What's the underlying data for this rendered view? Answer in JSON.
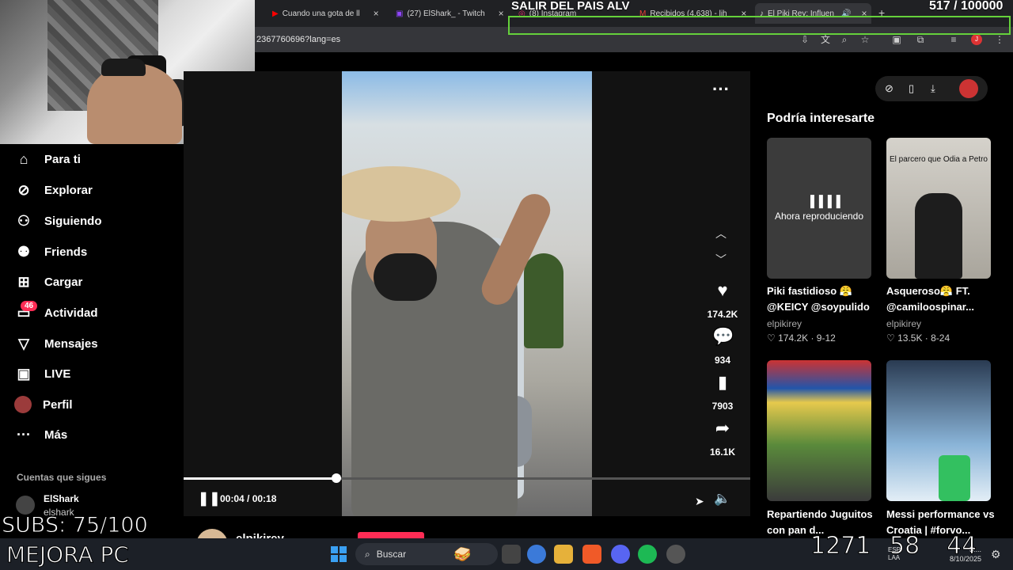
{
  "browser": {
    "tabs": [
      {
        "label": "Cuando una gota de ll",
        "icon": "youtube-icon"
      },
      {
        "label": "(27) ElShark_ - Twitch",
        "icon": "twitch-icon"
      },
      {
        "label": "(8) Instagram",
        "icon": "instagram-icon"
      },
      {
        "label": "Recibidos (4.638) - lih",
        "icon": "gmail-icon"
      },
      {
        "label": "El Piki Rey: Influen",
        "icon": "tiktok-icon"
      }
    ],
    "new_tab": "+",
    "url": "2367760696?lang=es"
  },
  "stream_overlay": {
    "title": "SALIR DEL PAIS ALV",
    "counter": "517   / 100000",
    "subs": "SUBS: 75/100",
    "mejora": "MEJORA PC",
    "num_a": "1271",
    "num_b": "58",
    "num_c": "44"
  },
  "sidebar": {
    "items": [
      {
        "label": "Para ti",
        "icon": "home-icon"
      },
      {
        "label": "Explorar",
        "icon": "compass-icon"
      },
      {
        "label": "Siguiendo",
        "icon": "user-follow-icon"
      },
      {
        "label": "Friends",
        "icon": "friends-icon"
      },
      {
        "label": "Cargar",
        "icon": "upload-icon"
      },
      {
        "label": "Actividad",
        "icon": "inbox-icon"
      },
      {
        "label": "Mensajes",
        "icon": "send-icon"
      },
      {
        "label": "LIVE",
        "icon": "live-tv-icon"
      },
      {
        "label": "Perfil",
        "icon": "avatar-icon"
      },
      {
        "label": "Más",
        "icon": "more-icon"
      }
    ],
    "activity_badge": "46",
    "following_heading": "Cuentas que sigues",
    "following_user": "ElShark",
    "following_handle": "elshark_"
  },
  "player": {
    "likes": "174.2K",
    "comments": "934",
    "saves": "7903",
    "shares": "16.1K",
    "time": "00:04 / 00:18",
    "progress": 0.27,
    "author": "elpikirey"
  },
  "right_panel": {
    "title": "Podría interesarte",
    "cards": [
      {
        "title": "Piki fastidioso 😤 @KEICY @soypulido",
        "author": "elpikirey",
        "stats": "♡ 174.2K · 9-12",
        "overlay": "Ahora reproduciendo",
        "thumb": "#3b3b3b"
      },
      {
        "title": "Asqueroso😤 FT. @camiloospinar...",
        "author": "elpikirey",
        "stats": "♡ 13.5K · 8-24",
        "caption": "El parcero que Odia a Petro",
        "thumb": "#c9c5bd"
      },
      {
        "title": "Repartiendo Juguitos con pan d...",
        "author": "",
        "stats": "",
        "thumb": "#b84f3b"
      },
      {
        "title": "Messi performance vs Croatia | #forvo...",
        "author": "",
        "stats": "",
        "thumb": "#2a3b52"
      }
    ]
  },
  "taskbar": {
    "search": "Buscar",
    "lang": "ESP LAA",
    "date": "8/10/2025",
    "time": "3:..."
  }
}
